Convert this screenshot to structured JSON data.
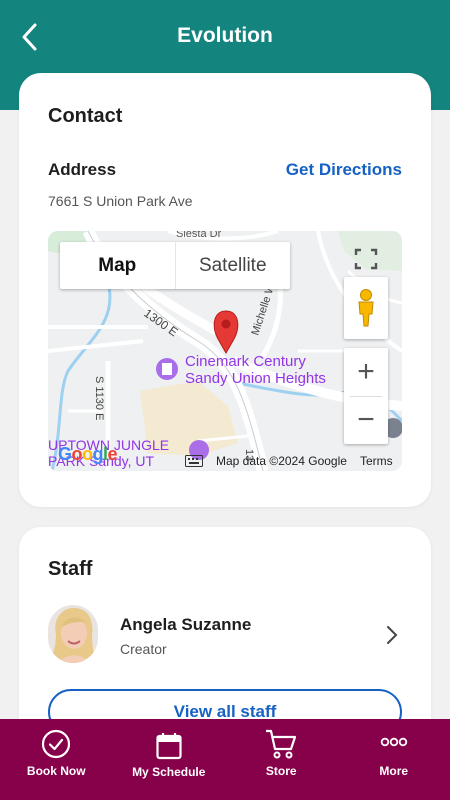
{
  "header": {
    "title": "Evolution",
    "back_icon": "chevron-left-icon",
    "bg_color": "#13857e"
  },
  "contact": {
    "title": "Contact",
    "address_label": "Address",
    "directions_label": "Get Directions",
    "address": "7661 S Union Park Ave",
    "map": {
      "toggle_map": "Map",
      "toggle_satellite": "Satellite",
      "poi_name": "Cinemark Century Sandy Union Heights",
      "poi_line1": "Cinemark Century",
      "poi_line2": "Sandy Union Heights",
      "street_1": "1300 E",
      "street_2": "Michelle W",
      "street_3": "Siesta Dr",
      "street_4": "S 1130 E",
      "street_5": "13",
      "poi_2_line1": "UPTOWN JUNGLE",
      "poi_2_line2": "PARK Sandy, UT",
      "map_data": "Map data ©2024 Google",
      "terms": "Terms",
      "google": "Google",
      "zoom_in": "+",
      "zoom_out": "−"
    }
  },
  "staff": {
    "title": "Staff",
    "member": {
      "name": "Angela Suzanne",
      "role": "Creator"
    },
    "view_all": "View all staff"
  },
  "nav": {
    "items": [
      {
        "label": "Book Now",
        "icon": "check-circle-icon"
      },
      {
        "label": "My Schedule",
        "icon": "calendar-icon"
      },
      {
        "label": "Store",
        "icon": "cart-icon"
      },
      {
        "label": "More",
        "icon": "more-dots-icon"
      }
    ],
    "bg_color": "#87004a"
  }
}
